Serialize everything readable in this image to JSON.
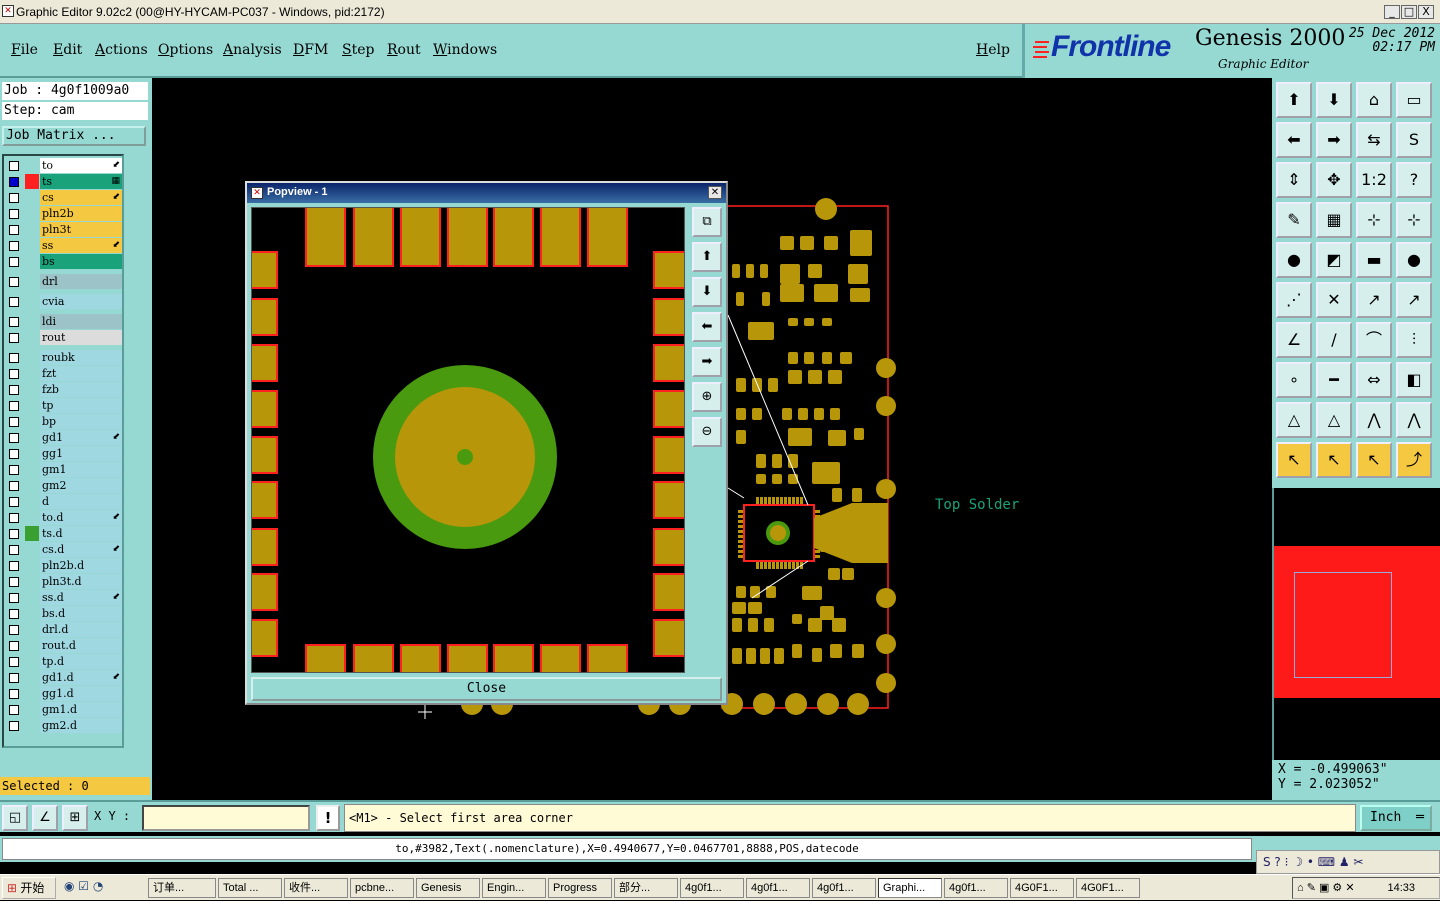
{
  "window": {
    "title": "Graphic Editor 9.02c2 (00@HY-HYCAM-PC037 - Windows, pid:2172)",
    "min_label": "_",
    "max_label": "□",
    "close_label": "X"
  },
  "menu": {
    "items": [
      "File",
      "Edit",
      "Actions",
      "Options",
      "Analysis",
      "DFM",
      "Step",
      "Rout",
      "Windows"
    ],
    "help": "Help"
  },
  "brand": {
    "logo": "Frontline",
    "product": "Genesis 2000",
    "subtitle": "Graphic Editor",
    "date": "25 Dec 2012",
    "time": "02:17 PM"
  },
  "job": {
    "job_line": "Job : 4g0f1009a0",
    "step_line": "Step: cam",
    "matrix_button": "Job Matrix ..."
  },
  "layers": [
    {
      "name": "to",
      "bg": "#ffffff",
      "swatch": "",
      "flag": "⬋",
      "checked": false
    },
    {
      "name": "ts",
      "bg": "#1aa37a",
      "swatch": "#ff2020",
      "flag": "▦",
      "checked": true
    },
    {
      "name": "cs",
      "bg": "#f5c842",
      "swatch": "",
      "flag": "⬋",
      "checked": false
    },
    {
      "name": "pln2b",
      "bg": "#f5c842",
      "swatch": "",
      "flag": "",
      "checked": false
    },
    {
      "name": "pln3t",
      "bg": "#f5c842",
      "swatch": "",
      "flag": "",
      "checked": false
    },
    {
      "name": "ss",
      "bg": "#f5c842",
      "swatch": "",
      "flag": "⬋",
      "checked": false
    },
    {
      "name": "bs",
      "bg": "#1aa37a",
      "swatch": "",
      "flag": "",
      "checked": false
    },
    {
      "name": "drl",
      "bg": "#9cc4c8",
      "swatch": "",
      "flag": "",
      "checked": false
    },
    {
      "name": "cvia",
      "bg": "#9fd8e0",
      "swatch": "",
      "flag": "",
      "checked": false
    },
    {
      "name": "ldi",
      "bg": "#9cc4c8",
      "swatch": "",
      "flag": "",
      "checked": false
    },
    {
      "name": "rout",
      "bg": "#dcdcdc",
      "swatch": "",
      "flag": "",
      "checked": false
    },
    {
      "name": "roubk",
      "bg": "#9fd8e0",
      "swatch": "",
      "flag": "",
      "checked": false
    },
    {
      "name": "fzt",
      "bg": "#9fd8e0",
      "swatch": "",
      "flag": "",
      "checked": false
    },
    {
      "name": "fzb",
      "bg": "#9fd8e0",
      "swatch": "",
      "flag": "",
      "checked": false
    },
    {
      "name": "tp",
      "bg": "#9fd8e0",
      "swatch": "",
      "flag": "",
      "checked": false
    },
    {
      "name": "bp",
      "bg": "#9fd8e0",
      "swatch": "",
      "flag": "",
      "checked": false
    },
    {
      "name": "gd1",
      "bg": "#9fd8e0",
      "swatch": "",
      "flag": "⬋",
      "checked": false
    },
    {
      "name": "gg1",
      "bg": "#9fd8e0",
      "swatch": "",
      "flag": "",
      "checked": false
    },
    {
      "name": "gm1",
      "bg": "#9fd8e0",
      "swatch": "",
      "flag": "",
      "checked": false
    },
    {
      "name": "gm2",
      "bg": "#9fd8e0",
      "swatch": "",
      "flag": "",
      "checked": false
    },
    {
      "name": "d",
      "bg": "#9fd8e0",
      "swatch": "",
      "flag": "",
      "checked": false
    },
    {
      "name": "to.d",
      "bg": "#9fd8e0",
      "swatch": "",
      "flag": "⬋",
      "checked": false
    },
    {
      "name": "ts.d",
      "bg": "#9fd8e0",
      "swatch": "#3aa032",
      "flag": "",
      "checked": false
    },
    {
      "name": "cs.d",
      "bg": "#9fd8e0",
      "swatch": "",
      "flag": "⬋",
      "checked": false
    },
    {
      "name": "pln2b.d",
      "bg": "#9fd8e0",
      "swatch": "",
      "flag": "",
      "checked": false
    },
    {
      "name": "pln3t.d",
      "bg": "#9fd8e0",
      "swatch": "",
      "flag": "",
      "checked": false
    },
    {
      "name": "ss.d",
      "bg": "#9fd8e0",
      "swatch": "",
      "flag": "⬋",
      "checked": false
    },
    {
      "name": "bs.d",
      "bg": "#9fd8e0",
      "swatch": "",
      "flag": "",
      "checked": false
    },
    {
      "name": "drl.d",
      "bg": "#9fd8e0",
      "swatch": "",
      "flag": "",
      "checked": false
    },
    {
      "name": "rout.d",
      "bg": "#9fd8e0",
      "swatch": "",
      "flag": "",
      "checked": false
    },
    {
      "name": "tp.d",
      "bg": "#9fd8e0",
      "swatch": "",
      "flag": "",
      "checked": false
    },
    {
      "name": "gd1.d",
      "bg": "#9fd8e0",
      "swatch": "",
      "flag": "⬋",
      "checked": false
    },
    {
      "name": "gg1.d",
      "bg": "#9fd8e0",
      "swatch": "",
      "flag": "",
      "checked": false
    },
    {
      "name": "gm1.d",
      "bg": "#9fd8e0",
      "swatch": "",
      "flag": "",
      "checked": false
    },
    {
      "name": "gm2.d",
      "bg": "#9fd8e0",
      "swatch": "",
      "flag": "",
      "checked": false
    }
  ],
  "selected_label": "Selected : 0",
  "canvas": {
    "label": "Top Solder",
    "label_color": "#1aa37a",
    "pad_color": "#b8960a",
    "outline_color": "#ff2020"
  },
  "popview": {
    "title": "Popview - 1",
    "close_label": "Close",
    "ring_color": "#4a9a10",
    "side_buttons": [
      "zoom-fit-icon",
      "pan-up-icon",
      "pan-down-icon",
      "pan-left-icon",
      "pan-right-icon",
      "zoom-in-icon",
      "zoom-out-icon"
    ]
  },
  "toolbar_icons": [
    "pan-up-icon",
    "pan-down-icon",
    "home-icon",
    "window-icon",
    "pan-left-icon",
    "pan-right-icon",
    "fit-icon",
    "s-icon",
    "zoom-fit-icon",
    "zoom-center-icon",
    "1-2-icon",
    "help-icon",
    "graphic-icon",
    "grid-icon",
    "snap-icon",
    "snap2-icon",
    "select-icon",
    "polygon-icon",
    "ruler-icon",
    "circle-icon",
    "net-icon",
    "cross-icon",
    "move-icon",
    "move2-icon",
    "line-icon",
    "pen-icon",
    "arc-icon",
    "ff-icon",
    "point-icon",
    "minus-icon",
    "measure-icon",
    "shapes-icon",
    "triangle-icon",
    "triangle2-icon",
    "arch-icon",
    "arch2-icon",
    "pointer-icon",
    "pointer2-icon",
    "pointer3-icon",
    "route-icon"
  ],
  "coords": {
    "x": "X = -0.499063\"",
    "y": "Y = 2.023052\""
  },
  "cmdbar": {
    "xy_label": "X Y :",
    "xy_value": "",
    "message": "<M1> - Select first area corner",
    "units": "Inch"
  },
  "status": "to,#3982,Text(.nomenclature),X=0.4940677,Y=0.0467701,8888,POS,datecode",
  "taskbar": {
    "start": "开始",
    "clock": "14:33",
    "tasks": [
      "订单...",
      "Total ...",
      "收件...",
      "pcbne...",
      "Genesis",
      "Engin...",
      "Progress",
      "部分...",
      "4g0f1...",
      "4g0f1...",
      "4g0f1...",
      "Graphi...",
      "4g0f1...",
      "4G0F1...",
      "4G0F1..."
    ]
  }
}
